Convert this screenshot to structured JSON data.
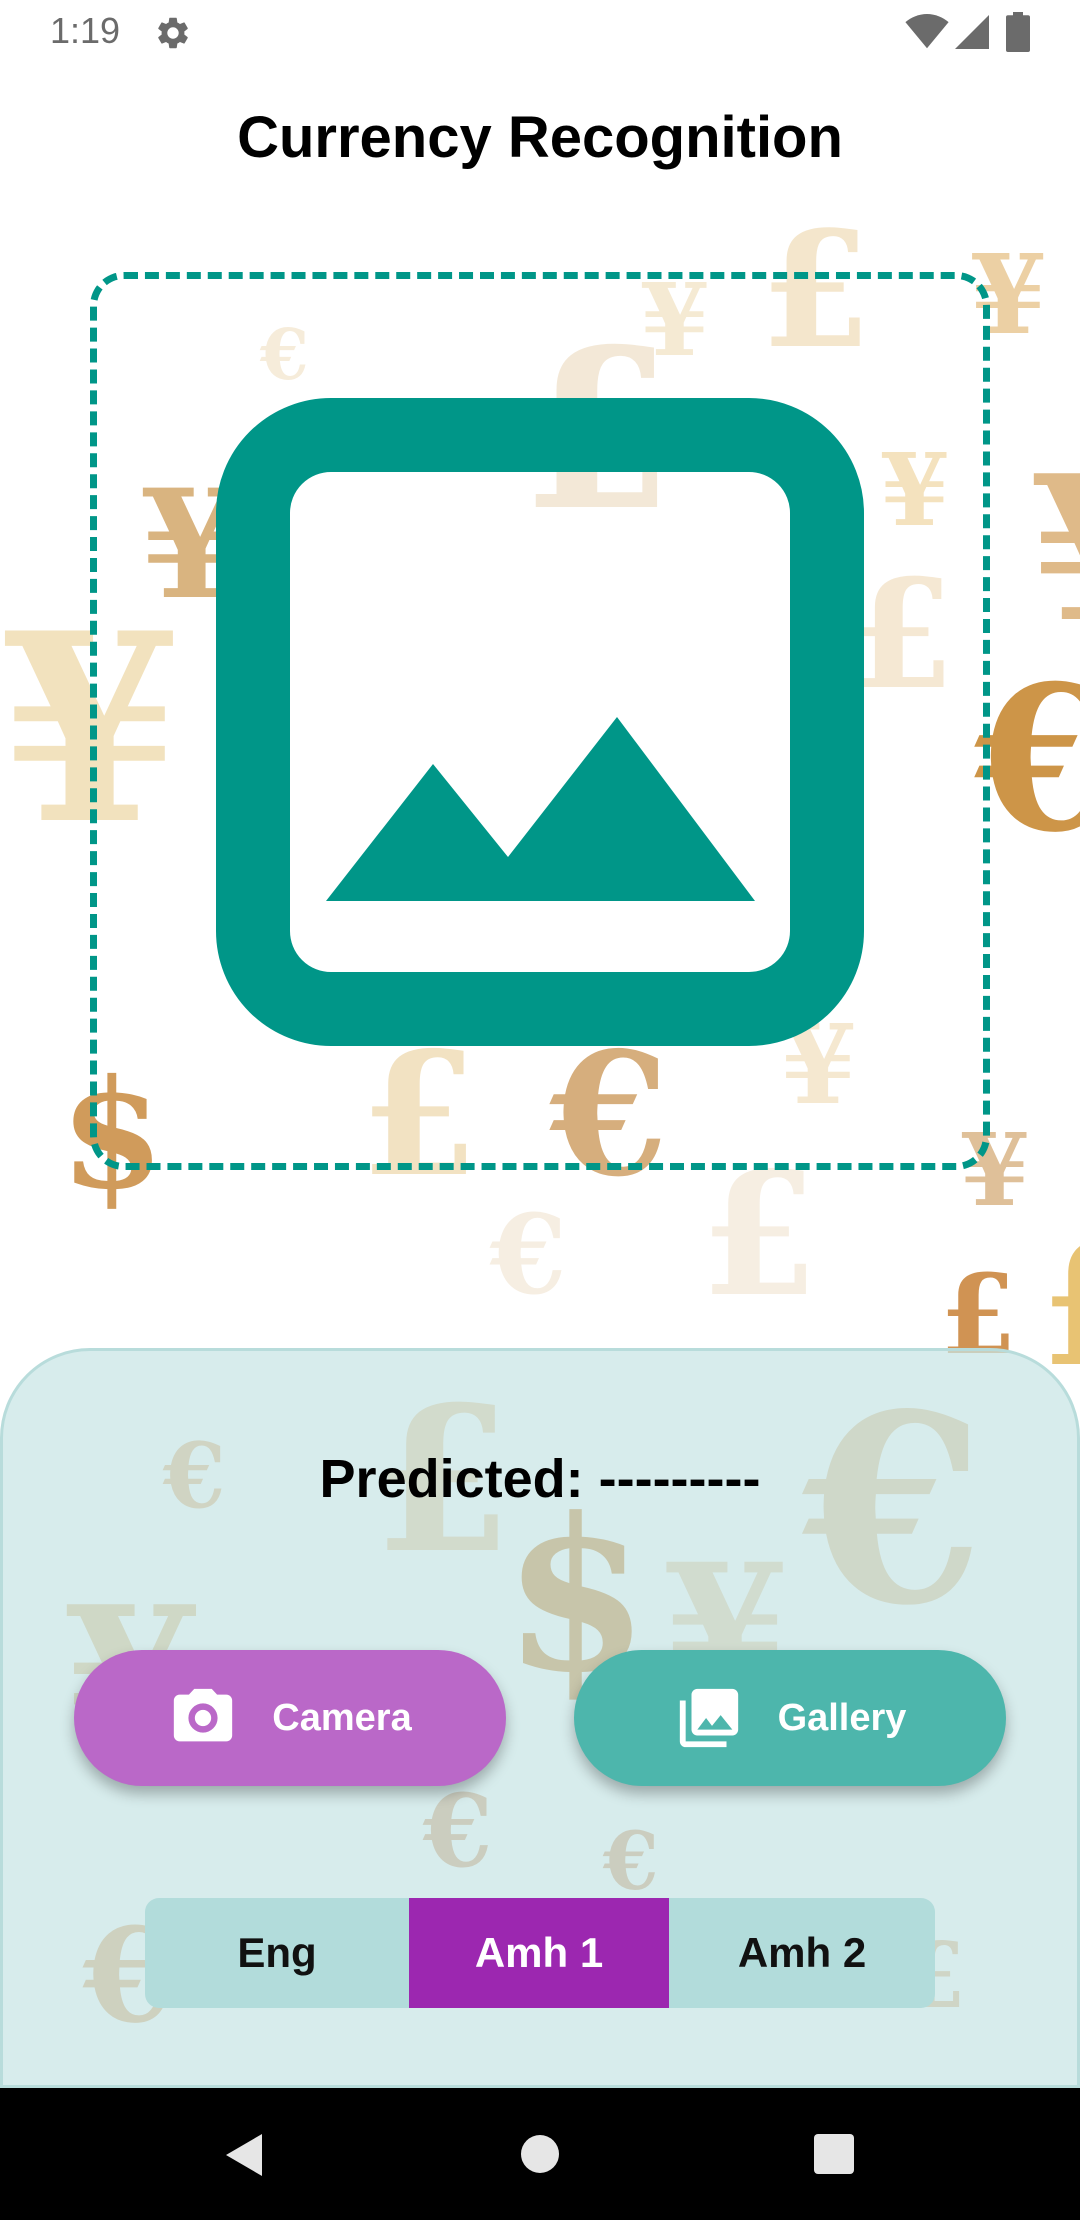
{
  "status_bar": {
    "time": "1:19",
    "icons": [
      "gear-icon",
      "wifi-icon",
      "signal-icon",
      "battery-icon"
    ]
  },
  "app": {
    "title": "Currency Recognition"
  },
  "image_area": {
    "placeholder_icon": "image-icon",
    "frame_color": "#009688"
  },
  "prediction": {
    "label": "Predicted:",
    "value": "---------"
  },
  "actions": {
    "camera_label": "Camera",
    "camera_icon": "camera-icon",
    "gallery_label": "Gallery",
    "gallery_icon": "photo-library-icon"
  },
  "language_toggle": {
    "options": [
      "Eng",
      "Amh 1",
      "Amh 2"
    ],
    "selected": "Amh 1"
  },
  "nav_bar": {
    "icons": [
      "back-icon",
      "home-icon",
      "recents-icon"
    ]
  },
  "colors": {
    "accent": "#009688",
    "camera_button": "#ba68c8",
    "gallery_button": "#4db6ac",
    "selected_language": "#9c27b0",
    "panel": "#d0e8e8"
  }
}
